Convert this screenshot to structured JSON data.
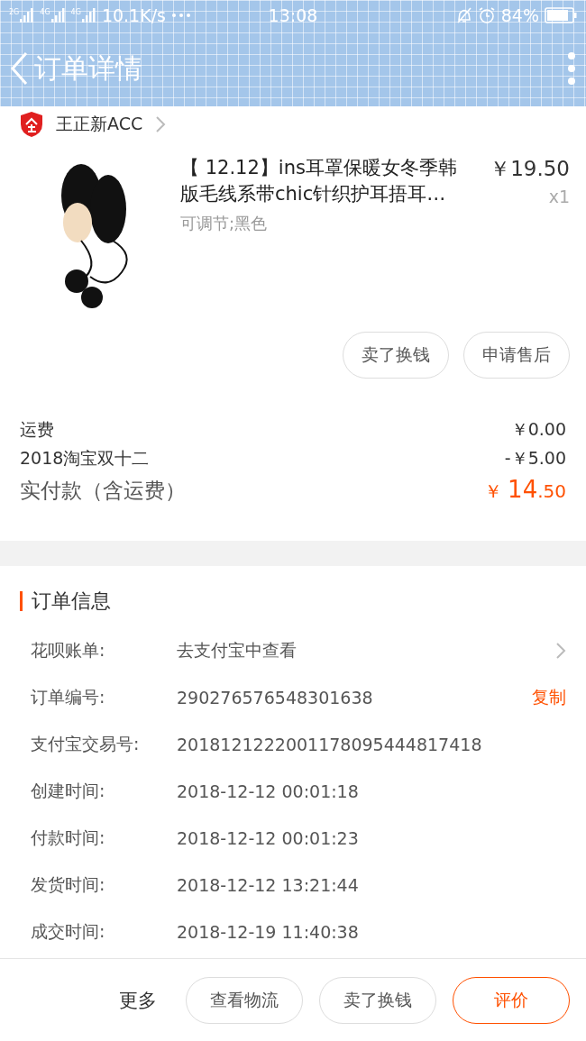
{
  "status_bar": {
    "networks": [
      "2G",
      "4G",
      "4G"
    ],
    "speed": "10.1K/s",
    "time": "13:08",
    "battery": "84%"
  },
  "header": {
    "title": "订单详情"
  },
  "shop": {
    "name": "王正新ACC"
  },
  "item": {
    "kind": "picture",
    "title": "【 12.12】ins耳罩保暖女冬季韩版毛线系带chic针织护耳捂耳…",
    "price": "￥19.50",
    "quantity": "x1",
    "sku": "可调节;黑色"
  },
  "item_buttons": [
    "卖了换钱",
    "申请售后"
  ],
  "fees": [
    {
      "label": "运费",
      "value": "￥0.00"
    },
    {
      "label": "2018淘宝双十二",
      "value": "-￥5.00"
    }
  ],
  "total": {
    "label": "实付款（含运费）",
    "currency": "￥",
    "integer": "14",
    "decimal": ".50"
  },
  "order_info": {
    "title": "订单信息",
    "rows": [
      {
        "kind": "link",
        "label": "花呗账单:",
        "value": "去支付宝中查看"
      },
      {
        "kind": "copy",
        "label": "订单编号:",
        "value": "290276576548301638",
        "action": "复制"
      },
      {
        "kind": "plain",
        "label": "支付宝交易号:",
        "value": "2018121222001178095444817418"
      },
      {
        "kind": "plain",
        "label": "创建时间:",
        "value": "2018-12-12 00:01:18"
      },
      {
        "kind": "plain",
        "label": "付款时间:",
        "value": "2018-12-12 00:01:23"
      },
      {
        "kind": "plain",
        "label": "发货时间:",
        "value": "2018-12-12 13:21:44"
      },
      {
        "kind": "plain",
        "label": "成交时间:",
        "value": "2018-12-19 11:40:38"
      }
    ]
  },
  "bottom_bar": {
    "more": "更多",
    "buttons": [
      {
        "label": "查看物流",
        "kind": "normal"
      },
      {
        "label": "卖了换钱",
        "kind": "normal"
      },
      {
        "label": "评价",
        "kind": "primary"
      }
    ]
  }
}
